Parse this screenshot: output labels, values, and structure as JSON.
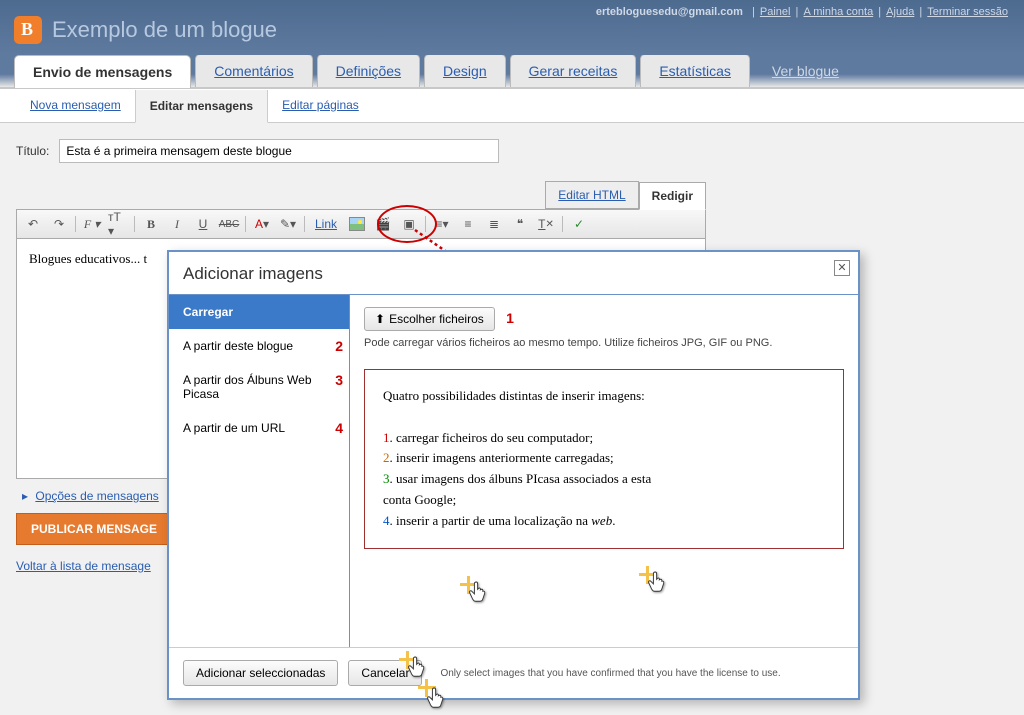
{
  "header": {
    "email": "ertebloguesedu@gmail.com",
    "links": {
      "painel": "Painel",
      "conta": "A minha conta",
      "ajuda": "Ajuda",
      "terminar": "Terminar sessão"
    },
    "blog_title": "Exemplo de um blogue"
  },
  "tabs": {
    "items": [
      "Envio de mensagens",
      "Comentários",
      "Definições",
      "Design",
      "Gerar receitas",
      "Estatísticas"
    ],
    "view": "Ver blogue"
  },
  "subtabs": {
    "nova": "Nova mensagem",
    "editar": "Editar mensagens",
    "paginas": "Editar páginas"
  },
  "editor": {
    "title_label": "Título:",
    "title_value": "Esta é a primeira mensagem deste blogue",
    "edit_html": "Editar HTML",
    "redigir": "Redigir",
    "link_tool": "Link",
    "content": "Blogues educativos... t",
    "options": "Opções de mensagens",
    "publish": "PUBLICAR MENSAGE",
    "back": "Voltar à lista de mensage"
  },
  "dialog": {
    "title": "Adicionar imagens",
    "side": {
      "carregar": "Carregar",
      "blog": "A partir deste blogue",
      "picasa": "A partir dos Álbuns Web Picasa",
      "url": "A partir de um URL"
    },
    "nums": {
      "n1": "1",
      "n2": "2",
      "n3": "3",
      "n4": "4"
    },
    "choose": "Escolher ficheiros",
    "hint": "Pode carregar vários ficheiros ao mesmo tempo. Utilize ficheiros JPG, GIF ou PNG.",
    "info": {
      "heading": "Quatro possibilidades distintas de inserir imagens:",
      "l1": "carregar ficheiros do seu computador;",
      "l2": "inserir imagens anteriormente carregadas;",
      "l3a": "usar imagens dos álbuns PIcasa associados a esta",
      "l3b": "conta Google;",
      "l4a": "inserir a partir de uma localização na ",
      "l4b": "web"
    },
    "footer": {
      "add": "Adicionar seleccionadas",
      "cancel": "Cancelar",
      "note": "Only select images that you have confirmed that you have the license to use."
    }
  }
}
